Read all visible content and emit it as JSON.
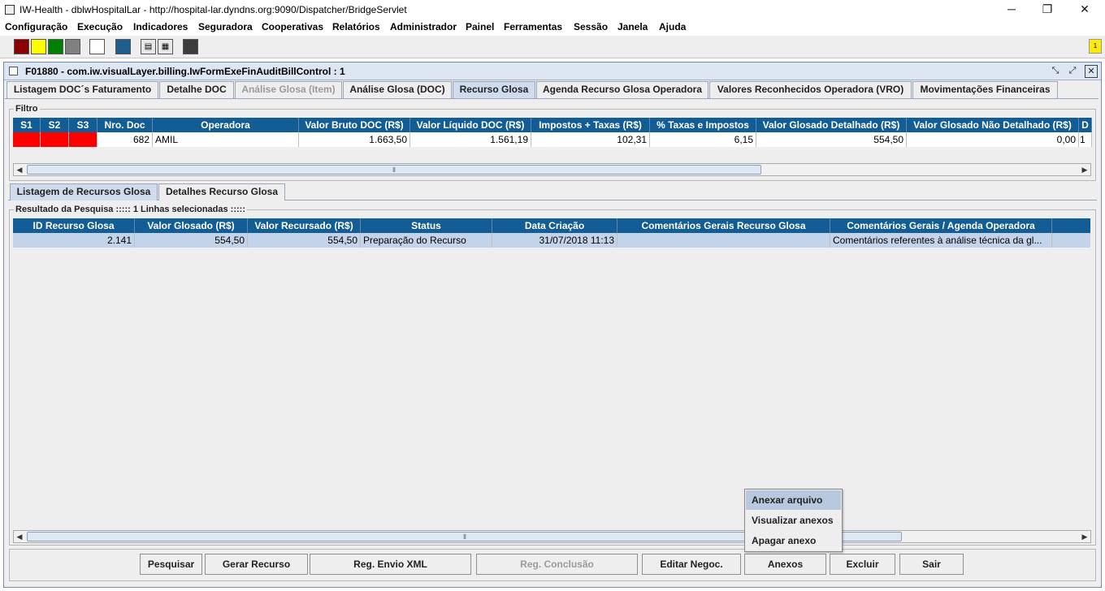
{
  "window": {
    "title": "IW-Health - dblwHospitalLar - http://hospital-lar.dyndns.org:9090/Dispatcher/BridgeServlet",
    "minimize_icon": "minimize-icon",
    "maximize_icon": "maximize-icon",
    "close_icon": "close-icon"
  },
  "menu": [
    "Configuração",
    "Execução",
    "Indicadores",
    "Seguradora",
    "Cooperativas",
    "Relatórios",
    "Administrador",
    "Painel",
    "Ferramentas",
    "Sessão",
    "Janela",
    "Ajuda"
  ],
  "toolbar": {
    "colors": [
      "#8b0000",
      "#ffff00",
      "#008000",
      "#808080",
      "#ffffff",
      "#1f5d8c",
      "#3c3c3c"
    ],
    "notify_badge": "1"
  },
  "frame": {
    "title": "F01880 - com.iw.visualLayer.billing.IwFormExeFinAuditBillControl : 1"
  },
  "tabs": [
    {
      "label": "Listagem DOC´s Faturamento"
    },
    {
      "label": "Detalhe DOC"
    },
    {
      "label": "Análise Glosa (Item)"
    },
    {
      "label": "Análise Glosa (DOC)"
    },
    {
      "label": "Recurso Glosa"
    },
    {
      "label": "Agenda Recurso Glosa Operadora"
    },
    {
      "label": "Valores Reconhecidos Operadora (VRO)"
    },
    {
      "label": "Movimentações Financeiras"
    }
  ],
  "filter": {
    "label": "Filtro",
    "columns": [
      "S1",
      "S2",
      "S3",
      "Nro. Doc",
      "Operadora",
      "Valor Bruto DOC (R$)",
      "Valor Líquido DOC (R$)",
      "Impostos + Taxas (R$)",
      "% Taxas e Impostos",
      "Valor Glosado Detalhado (R$)",
      "Valor Glosado Não Detalhado (R$)",
      "D"
    ],
    "row": [
      "",
      "",
      "",
      "682",
      "AMIL",
      "1.663,50",
      "1.561,19",
      "102,31",
      "6,15",
      "554,50",
      "0,00",
      "1"
    ],
    "status_color": "#ff0000"
  },
  "subtabs": [
    {
      "label": "Listagem de Recursos Glosa"
    },
    {
      "label": "Detalhes Recurso Glosa"
    }
  ],
  "results": {
    "label": "Resultado da Pesquisa ::::: 1 Linhas selecionadas :::::",
    "columns": [
      "ID Recurso Glosa",
      "Valor Glosado (R$)",
      "Valor Recursado (R$)",
      "Status",
      "Data Criação",
      "Comentários Gerais Recurso Glosa",
      "Comentários Gerais / Agenda Operadora"
    ],
    "row": [
      "2.141",
      "554,50",
      "554,50",
      "Preparação do Recurso",
      "31/07/2018 11:13",
      "",
      "Comentários referentes à análise técnica da gl..."
    ]
  },
  "buttons": [
    "Pesquisar",
    "Gerar Recurso",
    "Reg. Envio XML",
    "Reg. Conclusão",
    "Editar Negoc.",
    "Anexos",
    "Excluir",
    "Sair"
  ],
  "popup": [
    "Anexar arquivo",
    "Visualizar anexos",
    "Apagar anexo"
  ]
}
